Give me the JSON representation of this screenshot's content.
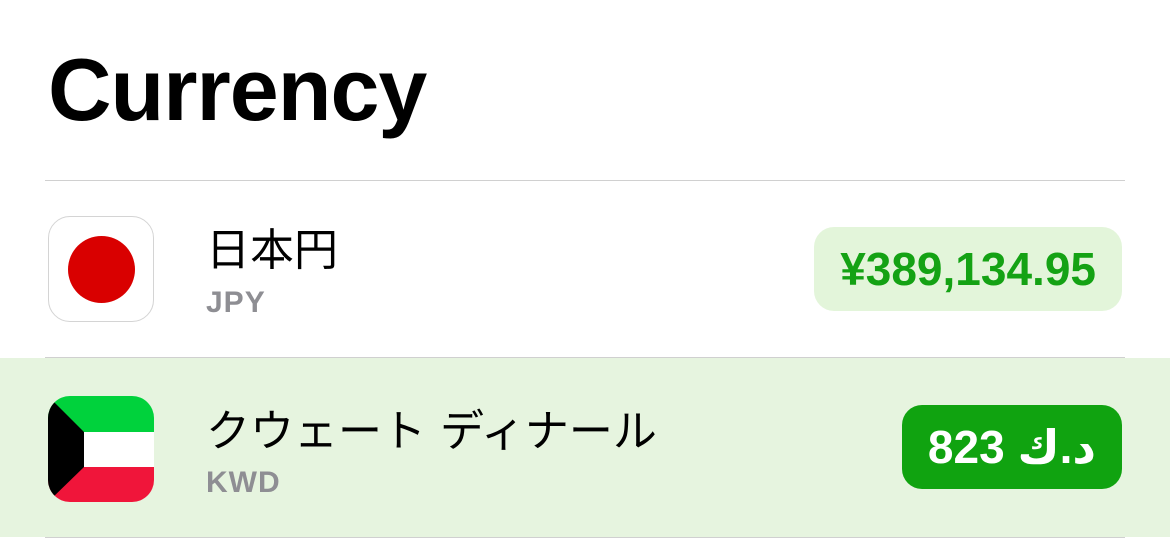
{
  "header": {
    "title": "Currency"
  },
  "currencies": [
    {
      "name": "日本円",
      "code": "JPY",
      "amount": "¥389,134.95",
      "flag_icon": "japan-flag-icon",
      "selected": false
    },
    {
      "name": "クウェート ディナール",
      "code": "KWD",
      "amount": "823 د.ك",
      "flag_icon": "kuwait-flag-icon",
      "selected": true
    }
  ],
  "colors": {
    "accent_green": "#10a310",
    "accent_green_text": "#14a214",
    "selected_row_bg": "#e6f4df",
    "amount_pill_bg": "#e3f5da",
    "secondary_text": "#8e8e93",
    "divider": "#d0d0d0",
    "japan_red": "#d90000",
    "kuwait_green": "#00d23c",
    "kuwait_red": "#f0153a",
    "kuwait_black": "#000000"
  }
}
